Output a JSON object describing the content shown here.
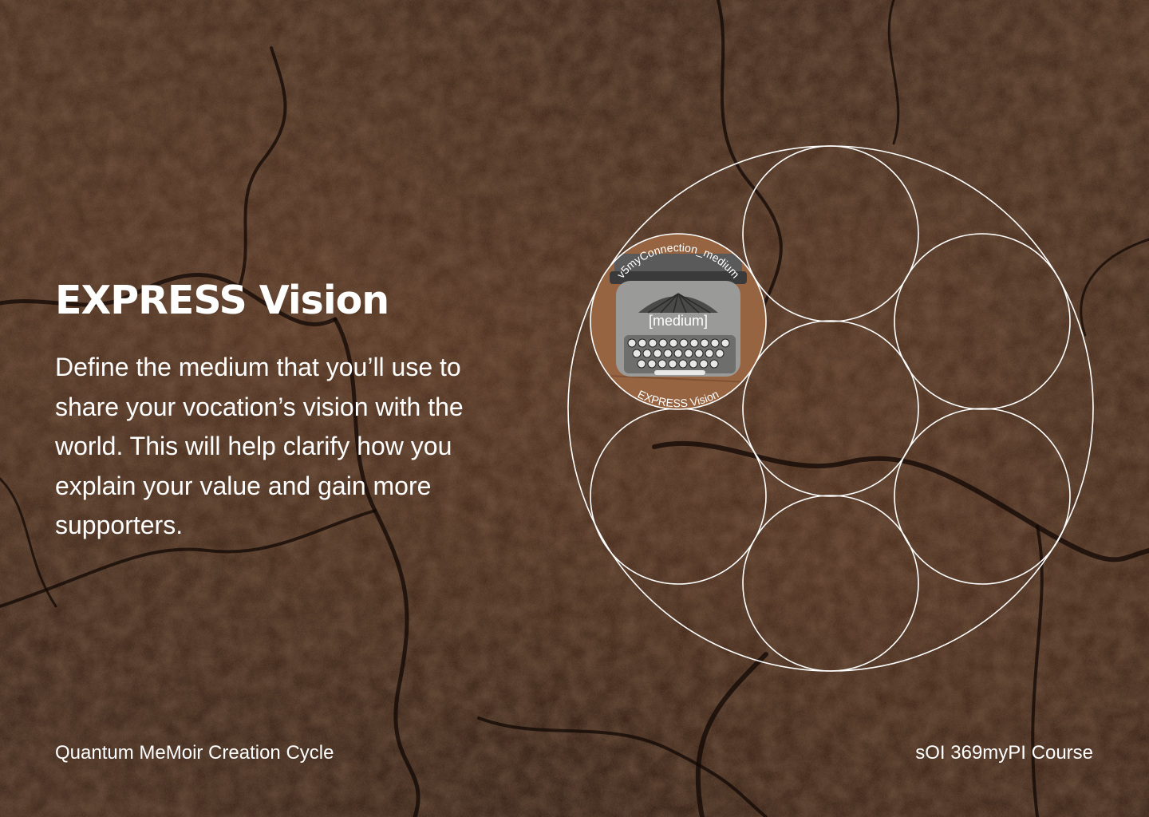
{
  "slide": {
    "title": "EXPRESS Vision",
    "description": "Define the medium that you’ll use to share your vocation’s vision with the world. This will help clarify how you explain your value and gain more supporters.",
    "footer_left": "Quantum MeMoir Creation Cycle",
    "footer_right": "sOI 369myPI Course"
  },
  "diagram": {
    "active_circle": {
      "top_arc_label": "v5myConnection_medium",
      "center_label": "[medium]",
      "bottom_arc_label": "EXPRESS Vision",
      "image": "typewriter-image"
    },
    "colors": {
      "stroke": "#ffffff",
      "background": "#3a2418"
    }
  }
}
